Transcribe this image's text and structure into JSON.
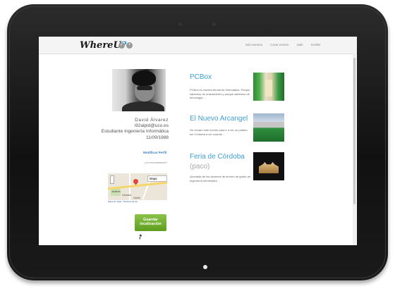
{
  "app": {
    "logo": "WhereU?",
    "logo_main": "WhereU",
    "logo_mark": "?"
  },
  "nav": {
    "items": [
      "Mis eventos",
      "Crear evento",
      "Salir",
      "DAWD"
    ]
  },
  "profile": {
    "name": "David Álvarez",
    "email": "i92alpid@uco.es",
    "role": "Estudiante Ingeniería Informática",
    "birthdate": "11/09/1988",
    "edit_link": "Modificar Perfil",
    "where_text": "¿Le encontramos?"
  },
  "map": {
    "select_value": "Mapa",
    "labels": [
      "Jardines",
      "Córdoba",
      "Centro"
    ],
    "footer": "Datos de mapa · Términos de uso"
  },
  "actions": {
    "save_label_1": "Guardar",
    "save_label_2": "localización"
  },
  "events": [
    {
      "title": "PCBox",
      "subtitle": "",
      "description": "PCBox es vuestra tienda de informática. Porque sabemos de ordenadores y porque sabemos de tecnología ..."
    },
    {
      "title": "El Nuevo Arcangel",
      "subtitle": "",
      "description": "He creado este evento para ir a ver un partido del Córdoba a ver cuando ..."
    },
    {
      "title": "Feria de Córdoba",
      "subtitle": "(paco)",
      "description": "Quedada de los alumnos de tercero de grado de Ingeniería Informática"
    }
  ],
  "colors": {
    "accent": "#3d9fd3",
    "button": "#6aa82a"
  }
}
